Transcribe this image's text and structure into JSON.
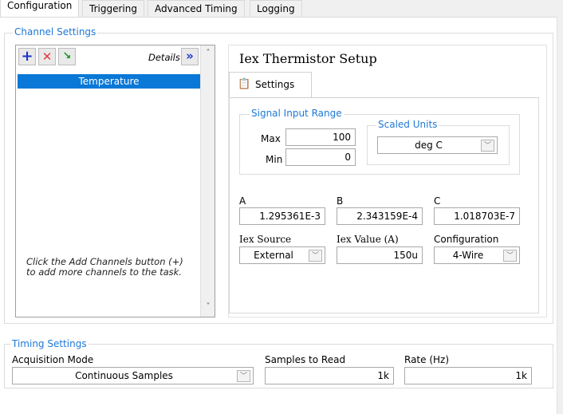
{
  "tabs": [
    {
      "label": "Configuration",
      "active": true
    },
    {
      "label": "Triggering",
      "active": false
    },
    {
      "label": "Advanced Timing",
      "active": false
    },
    {
      "label": "Logging",
      "active": false
    }
  ],
  "channel_settings": {
    "legend": "Channel Settings",
    "details_label": "Details",
    "details_button": "»",
    "toolbar": {
      "add_icon": "plus-icon",
      "remove_icon": "x-icon",
      "arrange_icon": "move-channel-icon"
    },
    "channels": [
      "Temperature"
    ],
    "hint": "Click the Add Channels button (+) to add more channels to the task."
  },
  "setup": {
    "title": "Iex Thermistor Setup",
    "subtab": "Settings",
    "signal_input_range": {
      "legend": "Signal Input Range",
      "max_label": "Max",
      "max_value": "100",
      "min_label": "Min",
      "min_value": "0"
    },
    "scaled_units": {
      "legend": "Scaled Units",
      "value": "deg C"
    },
    "coefficients": {
      "a_label": "A",
      "a_value": "1.295361E-3",
      "b_label": "B",
      "b_value": "2.343159E-4",
      "c_label": "C",
      "c_value": "1.018703E-7"
    },
    "iex_source_label": "Iex Source",
    "iex_source_value": "External",
    "iex_value_label": "Iex Value (A)",
    "iex_value": "150u",
    "configuration_label": "Configuration",
    "configuration_value": "4-Wire"
  },
  "timing_settings": {
    "legend": "Timing Settings",
    "acquisition_mode_label": "Acquisition Mode",
    "acquisition_mode_value": "Continuous Samples",
    "samples_label": "Samples to Read",
    "samples_value": "1k",
    "rate_label": "Rate (Hz)",
    "rate_value": "1k"
  },
  "colors": {
    "accent": "#1e78d6",
    "selection": "#0a78d7"
  }
}
